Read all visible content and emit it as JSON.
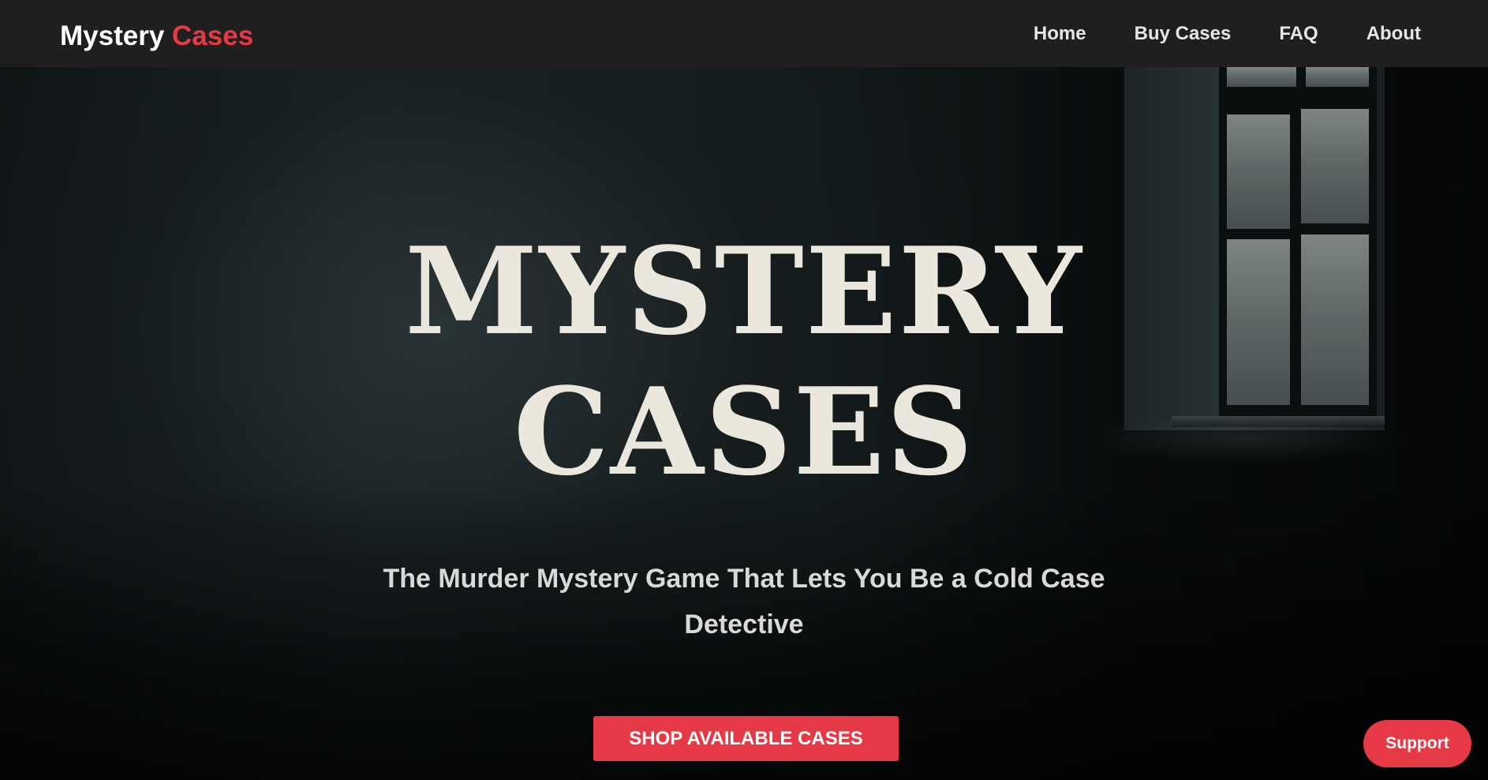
{
  "nav": {
    "brand_primary": "Mystery",
    "brand_accent": "Cases",
    "links": [
      {
        "label": "Home"
      },
      {
        "label": "Buy Cases"
      },
      {
        "label": "FAQ"
      },
      {
        "label": "About"
      }
    ]
  },
  "hero": {
    "title_line1": "MYSTERY",
    "title_line2": "CASES",
    "tagline": "The Murder Mystery Game That Lets You Be a Cold Case Detective",
    "cta_label": "SHOP AVAILABLE CASES"
  },
  "support": {
    "label": "Support"
  },
  "colors": {
    "accent": "#e63946",
    "navbar_bg": "#1f1f1f",
    "title_text": "#ece7dd"
  }
}
